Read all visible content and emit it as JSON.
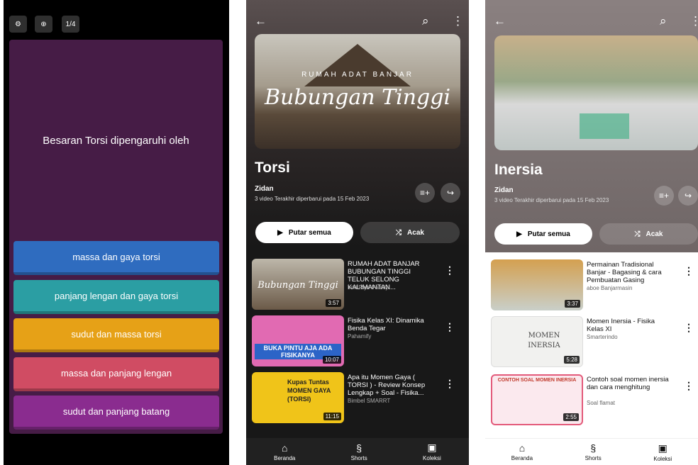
{
  "quiz": {
    "counter": "1/4",
    "question": "Besaran Torsi dipengaruhi oleh",
    "answers": [
      {
        "label": "massa dan gaya torsi",
        "color": "#2f6cbf"
      },
      {
        "label": "panjang lengan dan gaya torsi",
        "color": "#2b9ea3"
      },
      {
        "label": "sudut dan massa torsi",
        "color": "#e6a117"
      },
      {
        "label": "massa dan panjang lengan",
        "color": "#d04c63"
      },
      {
        "label": "sudut dan panjang batang",
        "color": "#8a2c8f"
      }
    ]
  },
  "playlist1": {
    "thumb_top": "RUMAH ADAT BANJAR",
    "thumb_script": "Bubungan Tinggi",
    "title": "Torsi",
    "owner": "Zidan",
    "meta": "3 video   Terakhir diperbarui pada 15 Feb 2023",
    "play_label": "Putar semua",
    "shuffle_label": "Acak",
    "videos": [
      {
        "title": "RUMAH ADAT BANJAR BUBUNGAN TINGGI TELUK SELONG KALIMANTAN...",
        "channel": "Yori Riyo Family",
        "duration": "3:57",
        "thumb_text": "Bubungan Tinggi"
      },
      {
        "title": "Fisika Kelas XI: Dinamika Benda Tegar",
        "channel": "Pahamify",
        "duration": "10:07",
        "thumb_text": "BUKA PINTU AJA ADA FISIKANYA"
      },
      {
        "title": "Apa itu Momen Gaya ( TORSI ) - Review Konsep Lengkap + Soal - Fisika...",
        "channel": "Bimbel SMARRT",
        "duration": "11:15",
        "thumb_text": "Kupas Tuntas MOMEN GAYA (TORSI)"
      }
    ],
    "nav": [
      "Beranda",
      "Shorts",
      "Koleksi"
    ]
  },
  "playlist2": {
    "title": "Inersia",
    "owner": "Zidan",
    "meta": "3 video   Terakhir diperbarui pada 15 Feb 2023",
    "play_label": "Putar semua",
    "shuffle_label": "Acak",
    "videos": [
      {
        "title": "Permainan Tradisional Banjar - Bagasing & cara Pembuatan Gasing",
        "channel": "aboe Banjarmasin",
        "duration": "3:37"
      },
      {
        "title": "Momen Inersia - Fisika Kelas XI",
        "channel": "Smarterindo",
        "duration": "5:28",
        "thumb_text": "MOMEN INERSIA"
      },
      {
        "title": "Contoh soal momen inersia dan cara menghitung",
        "channel": "Soal flamat",
        "duration": "2:55",
        "thumb_text": "CONTOH SOAL MOMEN INERSIA"
      }
    ],
    "nav": [
      "Beranda",
      "Shorts",
      "Koleksi"
    ]
  }
}
